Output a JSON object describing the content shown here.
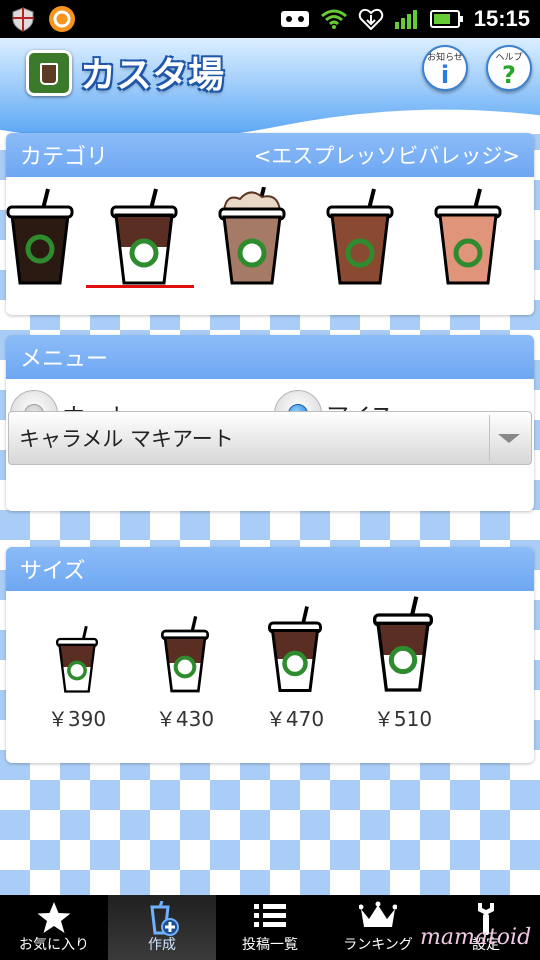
{
  "status_bar": {
    "time": "15:15"
  },
  "header": {
    "title": "カスタ場",
    "info_label": "お知らせ",
    "help_label": "ヘルプ"
  },
  "category": {
    "label": "カテゴリ",
    "current": "<エスプレッソビバレッジ>",
    "selected_index": 1
  },
  "menu": {
    "label": "メニュー",
    "hot_label": "ホット",
    "ice_label": "アイス",
    "selected_temp": "ice",
    "drink_select": "キャラメル マキアート"
  },
  "size": {
    "label": "サイズ",
    "prices": [
      "￥390",
      "￥430",
      "￥470",
      "￥510"
    ]
  },
  "bottom_nav": {
    "items": [
      {
        "label": "お気に入り",
        "icon": "star-icon"
      },
      {
        "label": "作成",
        "icon": "create-cup-icon"
      },
      {
        "label": "投稿一覧",
        "icon": "list-icon"
      },
      {
        "label": "ランキング",
        "icon": "crown-icon"
      },
      {
        "label": "設定",
        "icon": "wrench-icon"
      }
    ],
    "active_index": 1
  },
  "watermark": "mamatoid",
  "colors": {
    "accent_blue": "#6ea7f2",
    "checker_blue": "#a9cdf7",
    "selection_red": "#e01010"
  }
}
